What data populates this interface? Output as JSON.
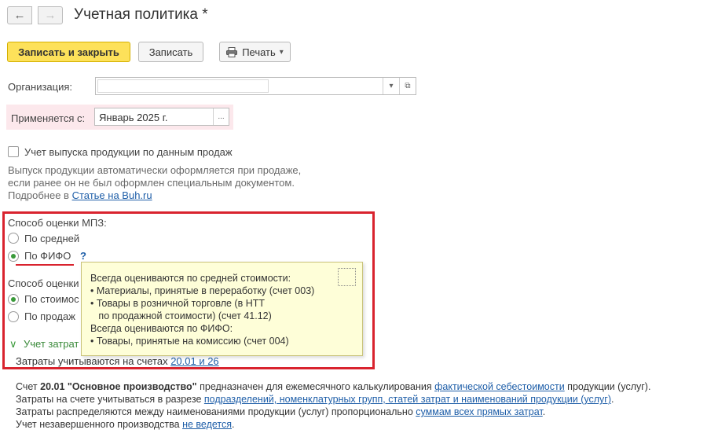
{
  "nav": {
    "back_glyph": "←",
    "forward_glyph": "→"
  },
  "title": "Учетная политика *",
  "toolbar": {
    "save_close": "Записать и закрыть",
    "save": "Записать",
    "print": "Печать",
    "print_arrow": "▾"
  },
  "org": {
    "label": "Организация:",
    "value": "",
    "dropdown_glyph": "▾",
    "open_glyph": "⧉"
  },
  "applies": {
    "label": "Применяется с:",
    "value": "Январь 2025 г.",
    "choose_glyph": "..."
  },
  "output_sales": {
    "checkbox_label": "Учет выпуска продукции по данным продаж",
    "checked": false,
    "hint_line1": "Выпуск продукции автоматически оформляется при продаже,",
    "hint_line2": "если ранее он не был оформлен специальным документом.",
    "more_prefix": "Подробнее в ",
    "more_link": "Статье на Buh.ru"
  },
  "mpz": {
    "header": "Способ оценки МПЗ:",
    "options": [
      {
        "label": "По средней",
        "checked": false
      },
      {
        "label": "По ФИФО",
        "checked": true
      }
    ],
    "help": "?"
  },
  "second_method": {
    "header": "Способ оценки",
    "options": [
      {
        "label": "По стоимос",
        "checked": true
      },
      {
        "label": "По продаж",
        "checked": false
      }
    ]
  },
  "costs": {
    "toggle": "Учет затрат",
    "chevron": "∨",
    "accounts_prefix": "Затраты учитываются на счетах ",
    "accounts_link": "20.01 и 26"
  },
  "tooltip": {
    "lines": [
      "Всегда оцениваются по средней стоимости:",
      "• Материалы, принятые в переработку (счет 003)",
      "• Товары в розничной торговле (в НТТ",
      "   по продажной стоимости) (счет 41.12)",
      "Всегда оцениваются по ФИФО:",
      "• Товары, принятые на комиссию (счет 004)"
    ]
  },
  "footer": {
    "l1_pre": "Счет ",
    "l1_bold1": "20.01",
    "l1_bold2": " \"Основное производство\"",
    "l1_mid": " предназначен для ежемесячного калькулирования ",
    "l1_link": "фактической себестоимости",
    "l1_post": " продукции (услуг).",
    "l2_pre": "Затраты на счете учитываться в разрезе ",
    "l2_link": "подразделений, номенклатурных групп, статей затрат и наименований продукции (услуг)",
    "l2_post": ".",
    "l3_pre": "Затраты распределяются между наименованиями продукции (услуг) пропорционально ",
    "l3_link": "суммам всех прямых затрат",
    "l3_post": ".",
    "l4_pre": "Учет незавершенного производства ",
    "l4_link": "не ведется",
    "l4_post": "."
  },
  "colors": {
    "accent_yellow": "#fde15a",
    "highlight_red": "#d9232e",
    "link_blue": "#1e5ea8",
    "tooltip_bg": "#fefed8"
  }
}
